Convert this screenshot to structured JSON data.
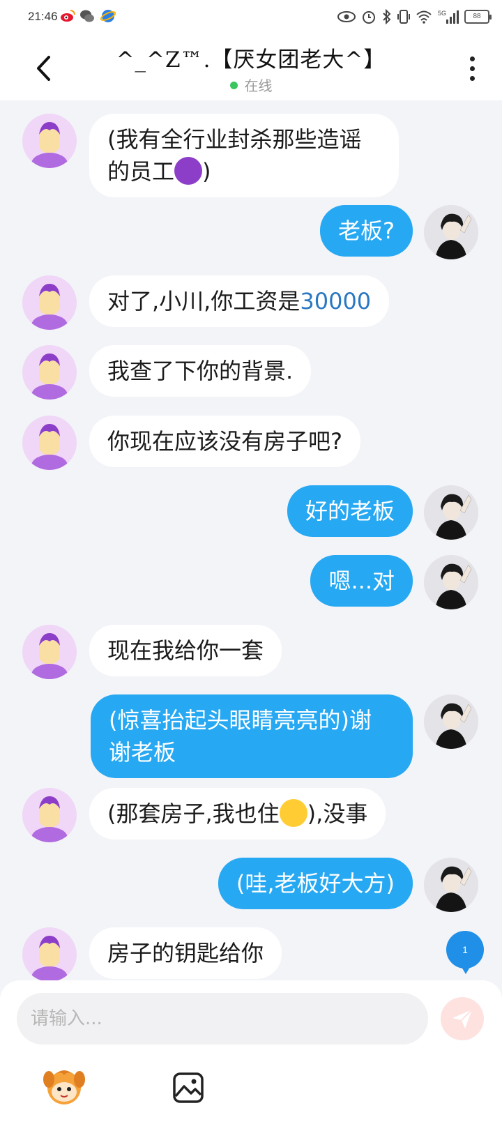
{
  "status_bar": {
    "time": "21:46",
    "network": "5G",
    "battery": "88"
  },
  "header": {
    "title": "^_^Z™.【厌女团老大^】",
    "status": "在线"
  },
  "messages": [
    {
      "side": "left",
      "text": "(我有全行业封杀那些造谣的员工👿)"
    },
    {
      "side": "right",
      "text": "老板?"
    },
    {
      "side": "left",
      "text": "对了,小川,你工资是30000"
    },
    {
      "side": "left",
      "text": "我查了下你的背景."
    },
    {
      "side": "left",
      "text": "你现在应该没有房子吧?"
    },
    {
      "side": "right",
      "text": "好的老板"
    },
    {
      "side": "right",
      "text": "嗯...对"
    },
    {
      "side": "left",
      "text": "现在我给你一套"
    },
    {
      "side": "right",
      "text": "(惊喜抬起头眼睛亮亮的)谢谢老板"
    },
    {
      "side": "left",
      "text": "(那套房子,我也住😍),没事"
    },
    {
      "side": "right",
      "text": "(哇,老板好大方)"
    },
    {
      "side": "left",
      "text": "房子的钥匙给你"
    }
  ],
  "msg_parts": {
    "m0_line1": "(我有全行业封杀那些造谣",
    "m0_line2": "的员工",
    "m0_after": ")",
    "m2_prefix": "对了,小川,你工资是",
    "m2_number": "30000",
    "m8_line1": "(惊喜抬起头眼睛亮亮的)谢",
    "m8_line2": "谢老板",
    "m9_before": "(那套房子,我也住",
    "m9_after": "),没事"
  },
  "unread_count": "1",
  "input": {
    "placeholder": "请输入..."
  },
  "icons": {
    "back": "back-arrow-icon",
    "more": "more-vertical-icon",
    "send": "send-icon",
    "emoji": "mascot-emoji-icon",
    "image": "image-icon"
  },
  "colors": {
    "outgoing_bubble": "#27a8f2",
    "incoming_bubble": "#ffffff",
    "background": "#f3f4f8",
    "online_dot": "#3ac55f",
    "number_link": "#2b78c2"
  }
}
